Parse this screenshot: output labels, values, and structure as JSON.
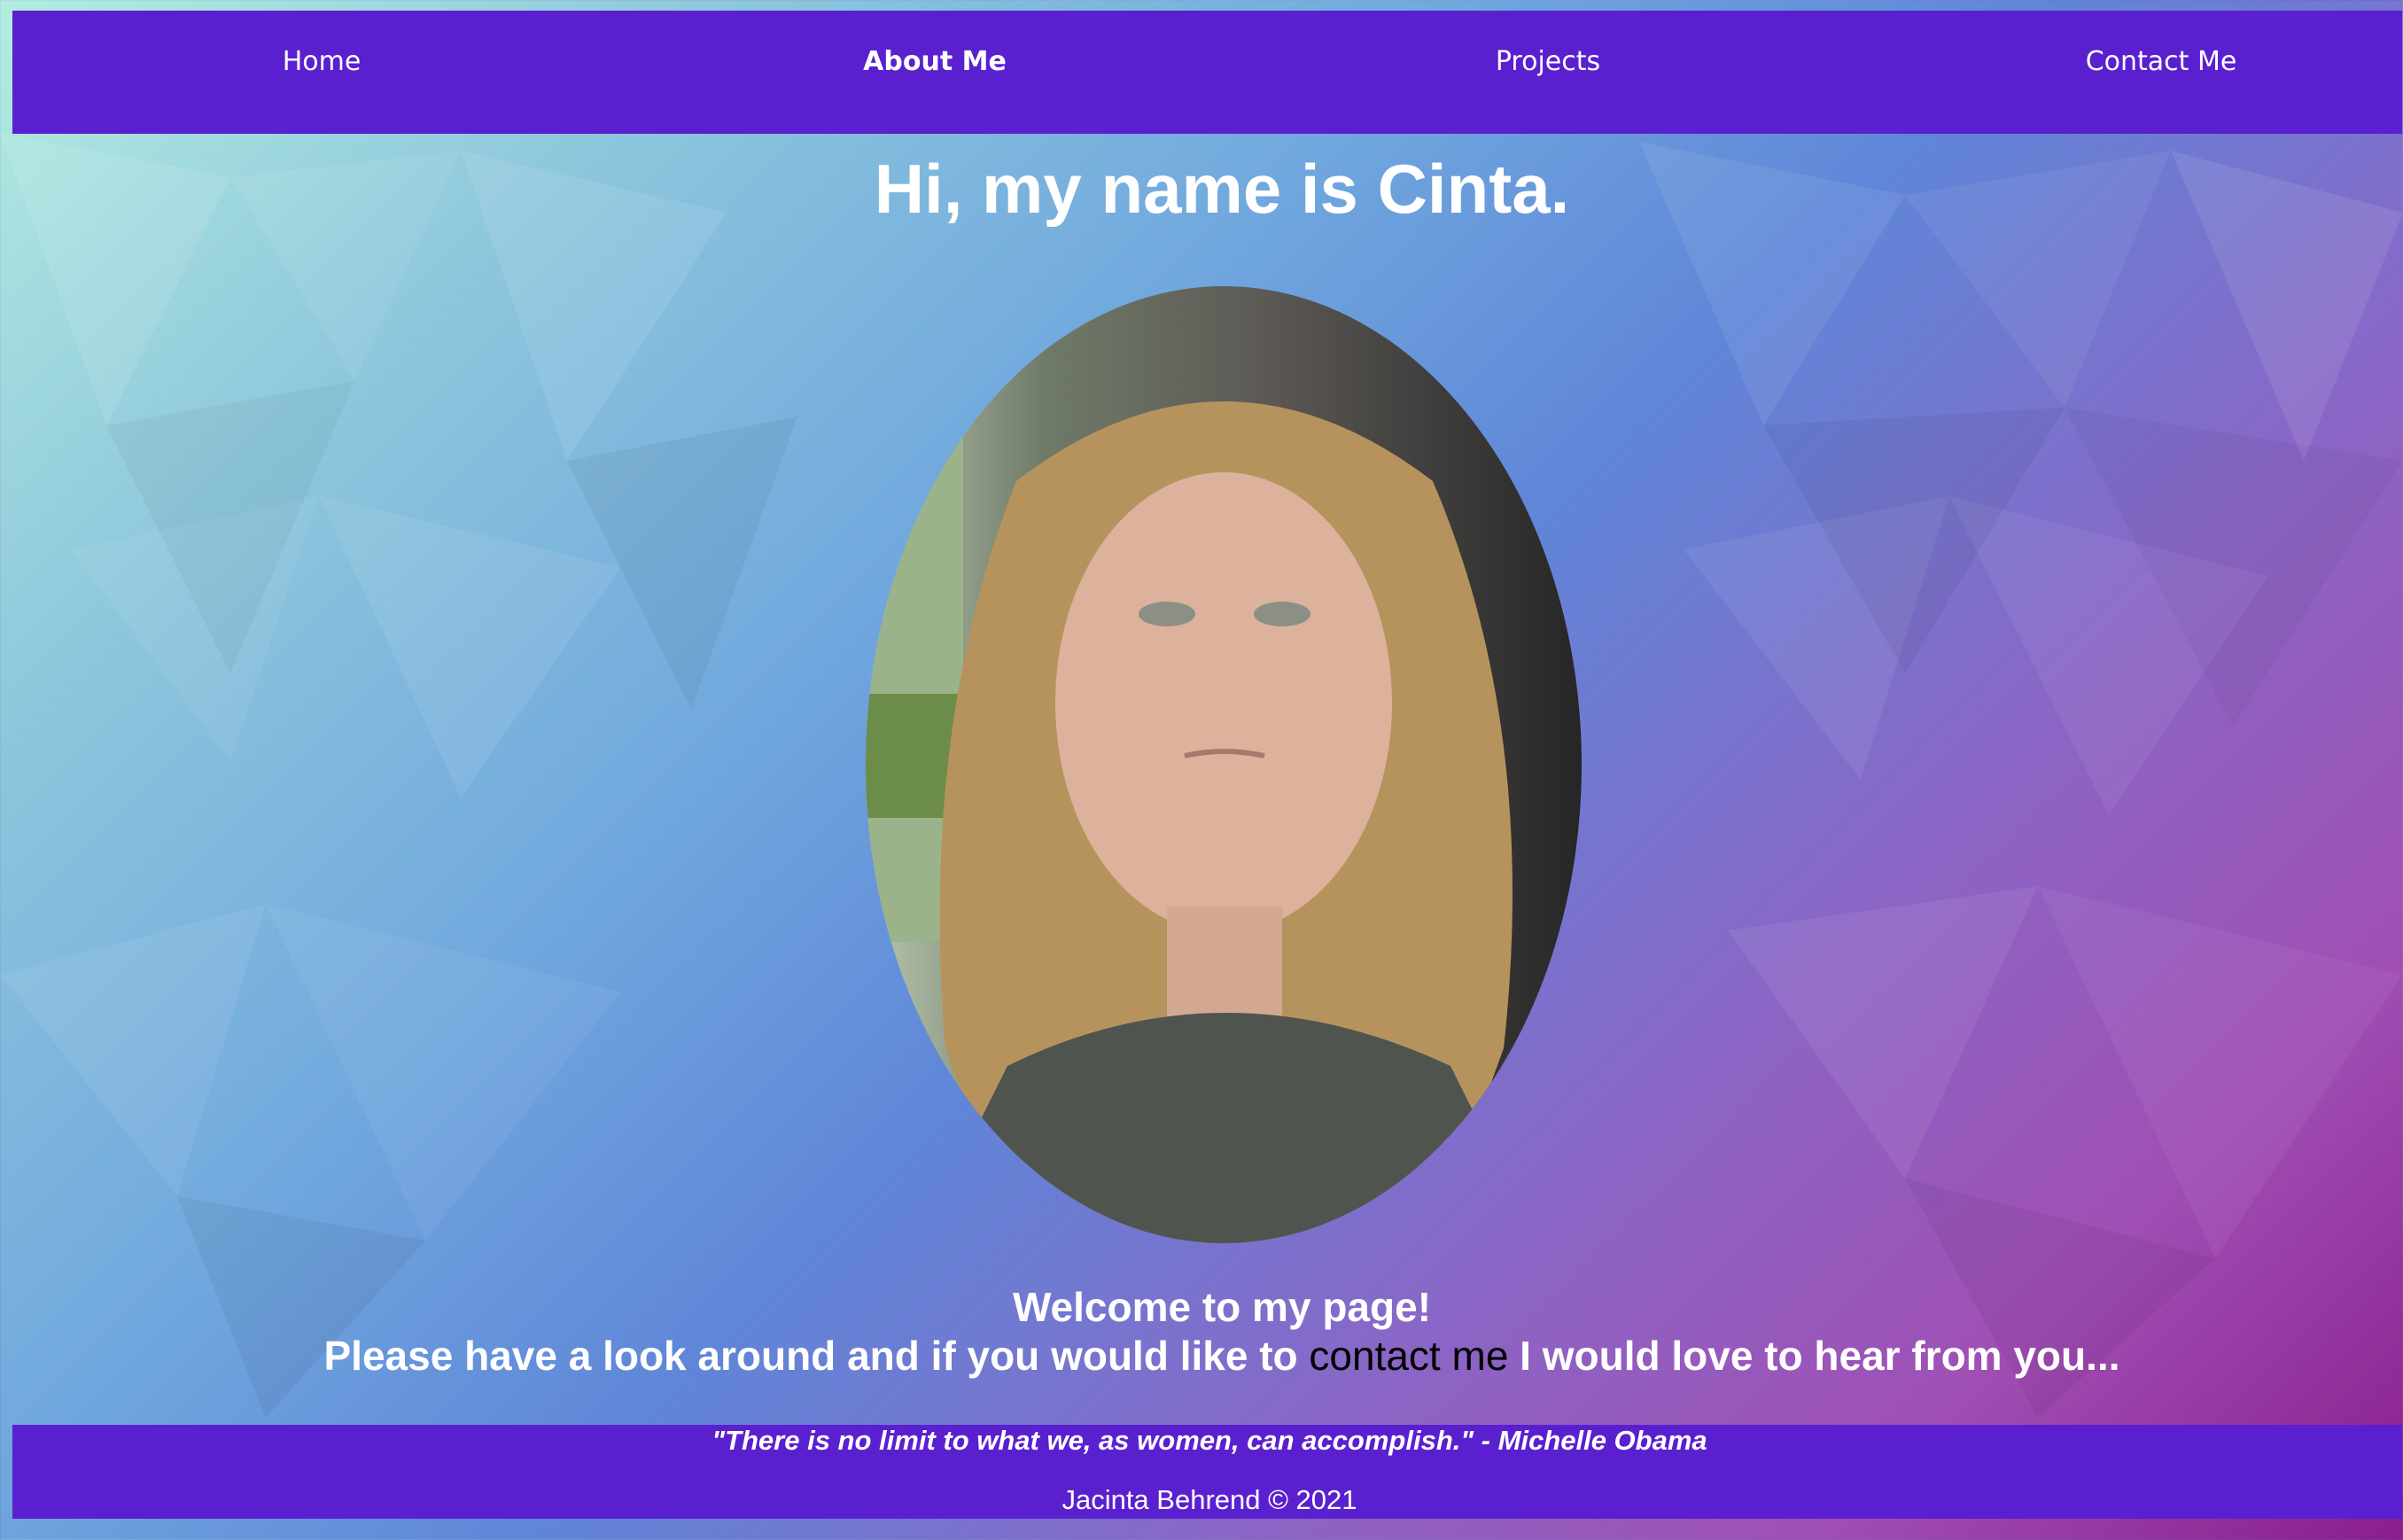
{
  "nav": {
    "items": [
      {
        "label": "Home",
        "active": false
      },
      {
        "label": "About Me",
        "active": true
      },
      {
        "label": "Projects",
        "active": false
      },
      {
        "label": "Contact Me",
        "active": false
      }
    ]
  },
  "main": {
    "title": "Hi, my name is Cinta.",
    "welcome": "Welcome to my page!",
    "intro_before": "Please have a look around and if you would like to ",
    "intro_link": "contact me",
    "intro_after": " I would love to hear from you..."
  },
  "footer": {
    "quote": "\"There is no limit to what we, as women, can accomplish.\" - Michelle Obama",
    "copyright": "Jacinta Behrend © 2021"
  },
  "colors": {
    "nav_bg": "#5a20d0",
    "footer_bg": "#5a20d0",
    "text": "#ffffff",
    "link": "#000000"
  }
}
